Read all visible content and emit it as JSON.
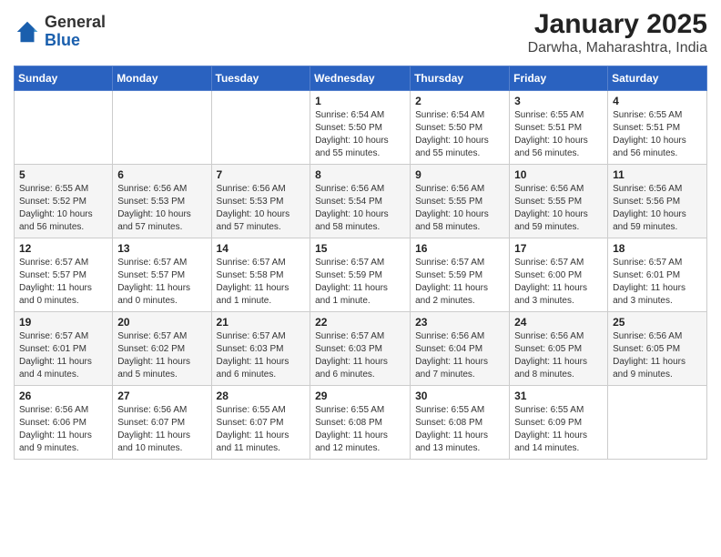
{
  "header": {
    "logo_general": "General",
    "logo_blue": "Blue",
    "title": "January 2025",
    "subtitle": "Darwha, Maharashtra, India"
  },
  "weekdays": [
    "Sunday",
    "Monday",
    "Tuesday",
    "Wednesday",
    "Thursday",
    "Friday",
    "Saturday"
  ],
  "weeks": [
    [
      {
        "day": "",
        "info": ""
      },
      {
        "day": "",
        "info": ""
      },
      {
        "day": "",
        "info": ""
      },
      {
        "day": "1",
        "info": "Sunrise: 6:54 AM\nSunset: 5:50 PM\nDaylight: 10 hours and 55 minutes."
      },
      {
        "day": "2",
        "info": "Sunrise: 6:54 AM\nSunset: 5:50 PM\nDaylight: 10 hours and 55 minutes."
      },
      {
        "day": "3",
        "info": "Sunrise: 6:55 AM\nSunset: 5:51 PM\nDaylight: 10 hours and 56 minutes."
      },
      {
        "day": "4",
        "info": "Sunrise: 6:55 AM\nSunset: 5:51 PM\nDaylight: 10 hours and 56 minutes."
      }
    ],
    [
      {
        "day": "5",
        "info": "Sunrise: 6:55 AM\nSunset: 5:52 PM\nDaylight: 10 hours and 56 minutes."
      },
      {
        "day": "6",
        "info": "Sunrise: 6:56 AM\nSunset: 5:53 PM\nDaylight: 10 hours and 57 minutes."
      },
      {
        "day": "7",
        "info": "Sunrise: 6:56 AM\nSunset: 5:53 PM\nDaylight: 10 hours and 57 minutes."
      },
      {
        "day": "8",
        "info": "Sunrise: 6:56 AM\nSunset: 5:54 PM\nDaylight: 10 hours and 58 minutes."
      },
      {
        "day": "9",
        "info": "Sunrise: 6:56 AM\nSunset: 5:55 PM\nDaylight: 10 hours and 58 minutes."
      },
      {
        "day": "10",
        "info": "Sunrise: 6:56 AM\nSunset: 5:55 PM\nDaylight: 10 hours and 59 minutes."
      },
      {
        "day": "11",
        "info": "Sunrise: 6:56 AM\nSunset: 5:56 PM\nDaylight: 10 hours and 59 minutes."
      }
    ],
    [
      {
        "day": "12",
        "info": "Sunrise: 6:57 AM\nSunset: 5:57 PM\nDaylight: 11 hours and 0 minutes."
      },
      {
        "day": "13",
        "info": "Sunrise: 6:57 AM\nSunset: 5:57 PM\nDaylight: 11 hours and 0 minutes."
      },
      {
        "day": "14",
        "info": "Sunrise: 6:57 AM\nSunset: 5:58 PM\nDaylight: 11 hours and 1 minute."
      },
      {
        "day": "15",
        "info": "Sunrise: 6:57 AM\nSunset: 5:59 PM\nDaylight: 11 hours and 1 minute."
      },
      {
        "day": "16",
        "info": "Sunrise: 6:57 AM\nSunset: 5:59 PM\nDaylight: 11 hours and 2 minutes."
      },
      {
        "day": "17",
        "info": "Sunrise: 6:57 AM\nSunset: 6:00 PM\nDaylight: 11 hours and 3 minutes."
      },
      {
        "day": "18",
        "info": "Sunrise: 6:57 AM\nSunset: 6:01 PM\nDaylight: 11 hours and 3 minutes."
      }
    ],
    [
      {
        "day": "19",
        "info": "Sunrise: 6:57 AM\nSunset: 6:01 PM\nDaylight: 11 hours and 4 minutes."
      },
      {
        "day": "20",
        "info": "Sunrise: 6:57 AM\nSunset: 6:02 PM\nDaylight: 11 hours and 5 minutes."
      },
      {
        "day": "21",
        "info": "Sunrise: 6:57 AM\nSunset: 6:03 PM\nDaylight: 11 hours and 6 minutes."
      },
      {
        "day": "22",
        "info": "Sunrise: 6:57 AM\nSunset: 6:03 PM\nDaylight: 11 hours and 6 minutes."
      },
      {
        "day": "23",
        "info": "Sunrise: 6:56 AM\nSunset: 6:04 PM\nDaylight: 11 hours and 7 minutes."
      },
      {
        "day": "24",
        "info": "Sunrise: 6:56 AM\nSunset: 6:05 PM\nDaylight: 11 hours and 8 minutes."
      },
      {
        "day": "25",
        "info": "Sunrise: 6:56 AM\nSunset: 6:05 PM\nDaylight: 11 hours and 9 minutes."
      }
    ],
    [
      {
        "day": "26",
        "info": "Sunrise: 6:56 AM\nSunset: 6:06 PM\nDaylight: 11 hours and 9 minutes."
      },
      {
        "day": "27",
        "info": "Sunrise: 6:56 AM\nSunset: 6:07 PM\nDaylight: 11 hours and 10 minutes."
      },
      {
        "day": "28",
        "info": "Sunrise: 6:55 AM\nSunset: 6:07 PM\nDaylight: 11 hours and 11 minutes."
      },
      {
        "day": "29",
        "info": "Sunrise: 6:55 AM\nSunset: 6:08 PM\nDaylight: 11 hours and 12 minutes."
      },
      {
        "day": "30",
        "info": "Sunrise: 6:55 AM\nSunset: 6:08 PM\nDaylight: 11 hours and 13 minutes."
      },
      {
        "day": "31",
        "info": "Sunrise: 6:55 AM\nSunset: 6:09 PM\nDaylight: 11 hours and 14 minutes."
      },
      {
        "day": "",
        "info": ""
      }
    ]
  ]
}
